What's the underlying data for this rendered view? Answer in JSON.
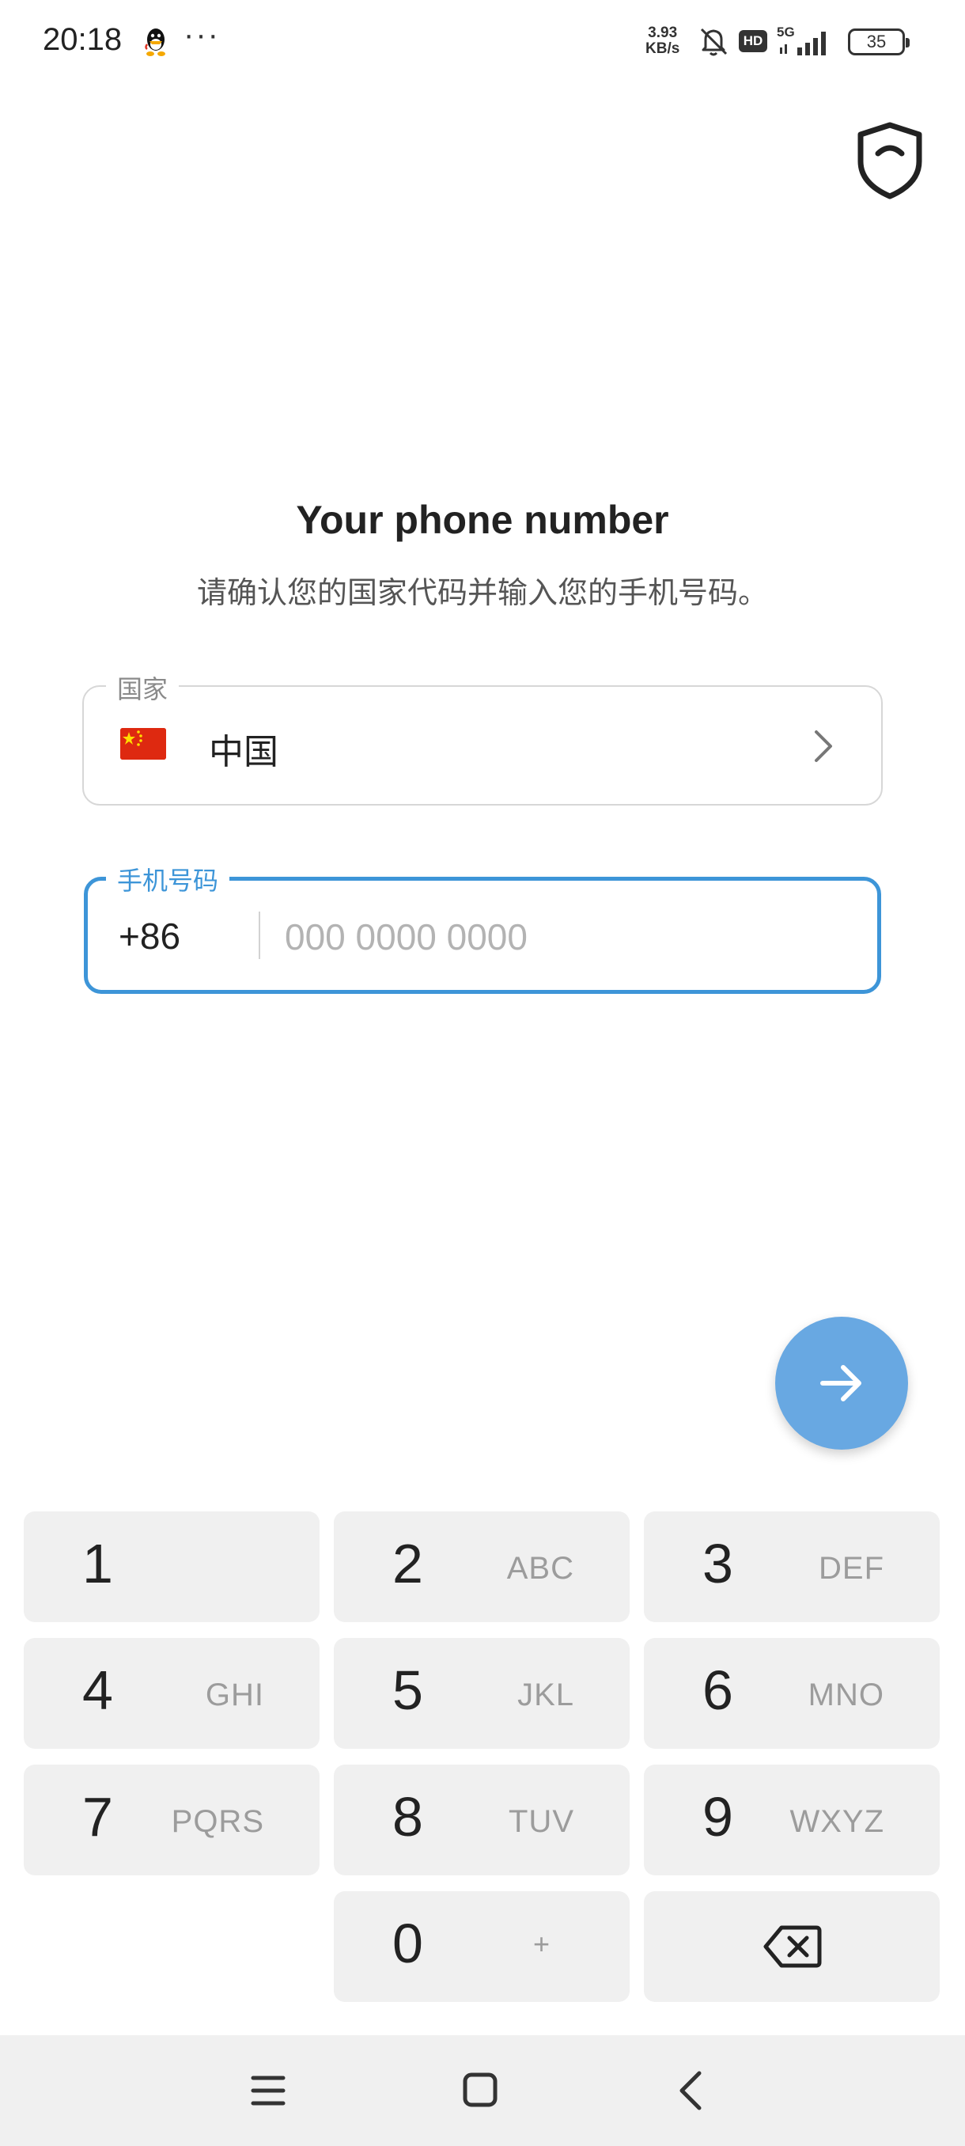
{
  "status_bar": {
    "time": "20:18",
    "more": "···",
    "speed_value": "3.93",
    "speed_unit": "KB/s",
    "hd": "HD",
    "network": "5G",
    "battery": "35",
    "icons": [
      "qq-icon",
      "bell-muted-icon",
      "hd-icon",
      "signal-icon",
      "battery-icon"
    ]
  },
  "header": {
    "shield_icon": "shield-icon"
  },
  "main": {
    "title": "Your phone number",
    "subtitle": "请确认您的国家代码并输入您的手机号码。",
    "country": {
      "label": "国家",
      "flag_icon": "china-flag-icon",
      "value": "中国"
    },
    "phone": {
      "label": "手机号码",
      "code": "+86",
      "value": "",
      "placeholder": "000 0000 0000"
    },
    "next_icon": "arrow-right-icon",
    "accent_color": "#3d95d8",
    "fab_color": "#68a8e2"
  },
  "keypad": {
    "keys": [
      {
        "digit": "1",
        "letters": ""
      },
      {
        "digit": "2",
        "letters": "ABC"
      },
      {
        "digit": "3",
        "letters": "DEF"
      },
      {
        "digit": "4",
        "letters": "GHI"
      },
      {
        "digit": "5",
        "letters": "JKL"
      },
      {
        "digit": "6",
        "letters": "MNO"
      },
      {
        "digit": "7",
        "letters": "PQRS"
      },
      {
        "digit": "8",
        "letters": "TUV"
      },
      {
        "digit": "9",
        "letters": "WXYZ"
      },
      {
        "digit": "0",
        "letters": "+"
      }
    ],
    "backspace_icon": "backspace-icon"
  },
  "nav_bar": {
    "icons": [
      "menu-icon",
      "home-icon",
      "back-icon"
    ]
  }
}
